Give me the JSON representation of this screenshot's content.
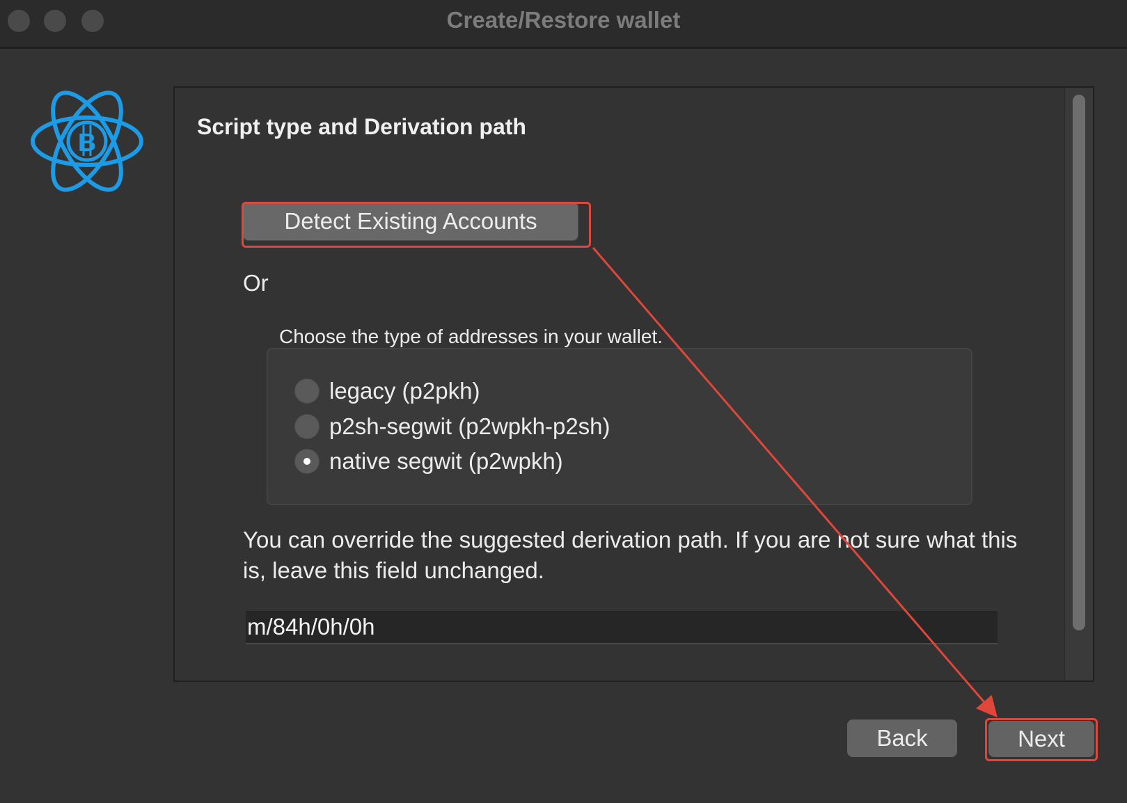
{
  "window": {
    "title": "Create/Restore wallet"
  },
  "logo": {
    "icon": "electrum-bitcoin-atom-logo",
    "color": "#1c9be6"
  },
  "panel": {
    "heading": "Script type and Derivation path",
    "detect_button_label": "Detect Existing Accounts",
    "or_label": "Or",
    "address_group_label": "Choose the type of addresses in your wallet.",
    "address_options": [
      {
        "label": "legacy (p2pkh)",
        "checked": false
      },
      {
        "label": "p2sh-segwit (p2wpkh-p2sh)",
        "checked": false
      },
      {
        "label": "native segwit (p2wpkh)",
        "checked": true
      }
    ],
    "derivation_note": "You can override the suggested derivation path. If you are not sure what this is, leave this field unchanged.",
    "derivation_path_value": "m/84h/0h/0h"
  },
  "footer": {
    "back_label": "Back",
    "next_label": "Next"
  },
  "colors": {
    "annotation": "#e0473a",
    "background": "#333333"
  }
}
